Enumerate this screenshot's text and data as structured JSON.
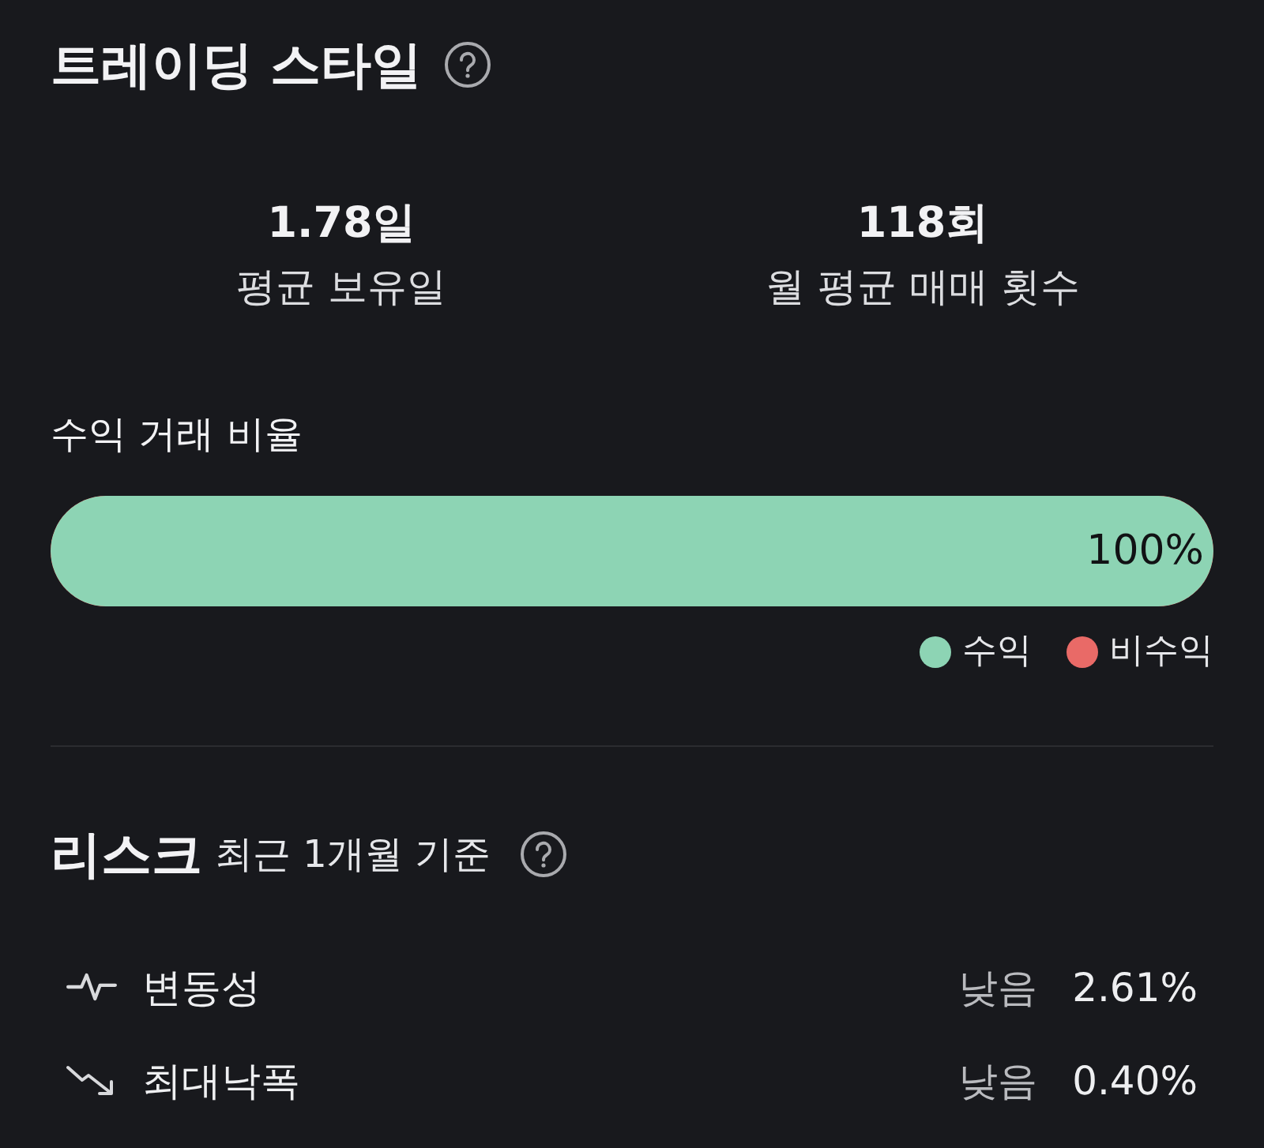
{
  "trading_style": {
    "title": "트레이딩 스타일",
    "stats": [
      {
        "value": "1.78일",
        "label": "평균 보유일"
      },
      {
        "value": "118회",
        "label": "월 평균 매매 횟수"
      }
    ],
    "win_ratio": {
      "label": "수익 거래 비율",
      "level": 1,
      "reading": "100%",
      "legend": [
        {
          "label": "수익",
          "color": "#8dd4b4"
        },
        {
          "label": "비수익",
          "color": "#e96a67"
        }
      ]
    }
  },
  "risk": {
    "title": "리스크",
    "subtitle": "최근 1개월 기준",
    "metrics": [
      {
        "kind": "volatility",
        "label": "변동성",
        "grade": "낮음",
        "value": "2.61%"
      },
      {
        "kind": "drawdown",
        "label": "최대낙폭",
        "grade": "낮음",
        "value": "0.40%"
      }
    ]
  }
}
